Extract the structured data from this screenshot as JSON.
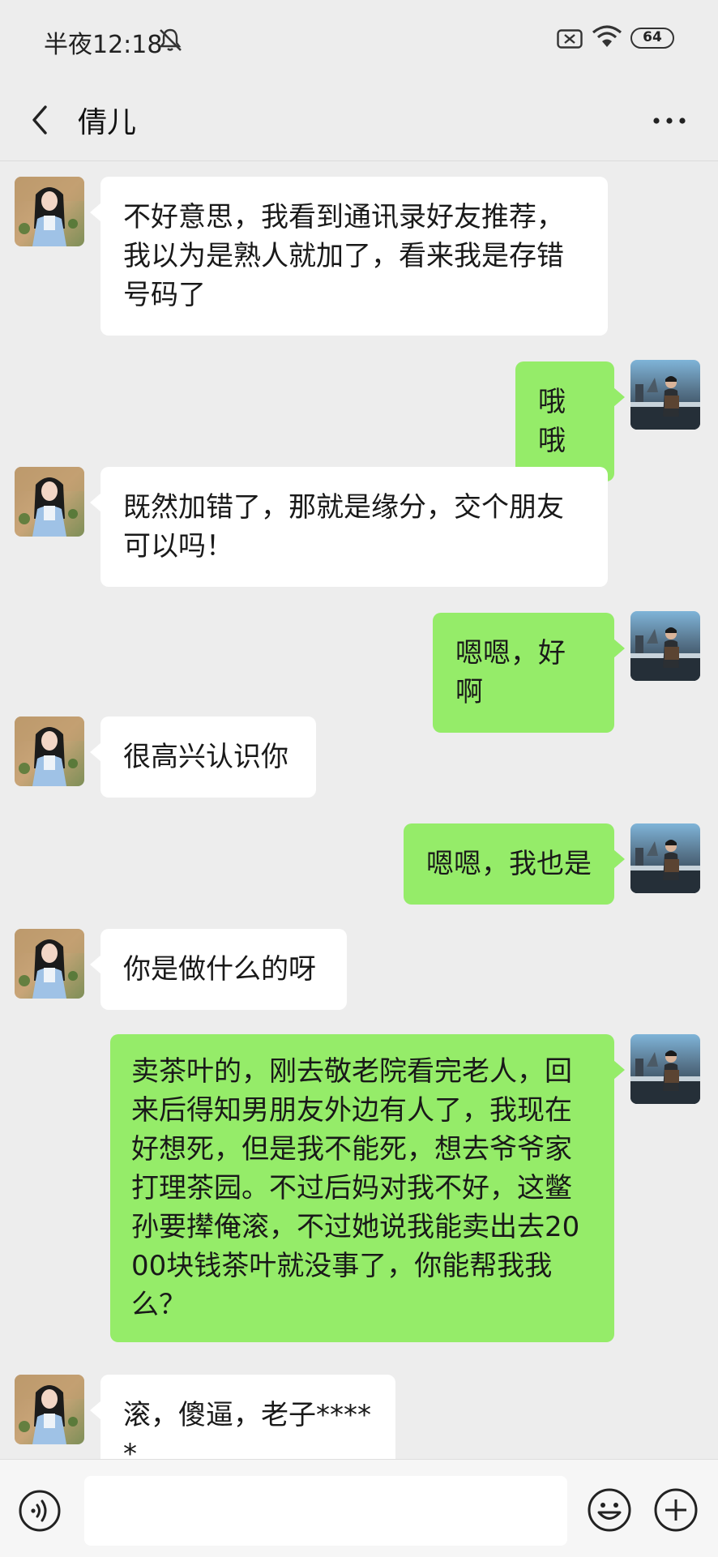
{
  "status_bar": {
    "time": "半夜12:18",
    "battery": "64"
  },
  "header": {
    "title": "倩儿"
  },
  "messages": [
    {
      "side": "left",
      "text": "不好意思，我看到通讯录好友推荐，我以为是熟人就加了，看来我是存错号码了"
    },
    {
      "side": "right",
      "text": "哦哦"
    },
    {
      "side": "left",
      "text": "既然加错了，那就是缘分，交个朋友可以吗！"
    },
    {
      "side": "right",
      "text": "嗯嗯，好啊"
    },
    {
      "side": "left",
      "text": "很高兴认识你"
    },
    {
      "side": "right",
      "text": "嗯嗯，我也是"
    },
    {
      "side": "left",
      "text": "你是做什么的呀"
    },
    {
      "side": "right",
      "text": "卖茶叶的，刚去敬老院看完老人，回来后得知男朋友外边有人了，我现在好想死，但是我不能死，想去爷爷家打理茶园。不过后妈对我不好，这鳖孙要撵俺滚，不过她说我能卖出去2000块钱茶叶就没事了，你能帮我我么？"
    },
    {
      "side": "left",
      "text": "滚，傻逼，老子*****"
    }
  ],
  "colors": {
    "background": "#ededed",
    "sent_bubble": "#95ec69",
    "received_bubble": "#ffffff"
  },
  "icons": {
    "back": "chevron-left-icon",
    "more": "more-dots-icon",
    "voice": "voice-icon",
    "emoji": "emoji-icon",
    "plus": "plus-icon"
  }
}
